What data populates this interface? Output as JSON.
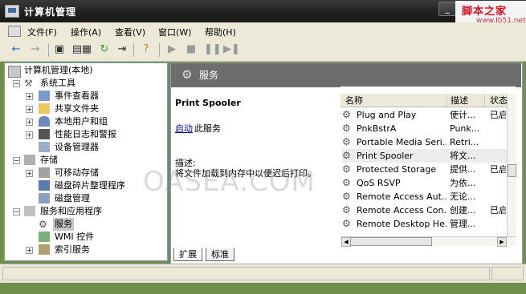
{
  "window": {
    "title": "计算机管理",
    "watermark_site": "脚本之家",
    "watermark_url": "www.Jb51.net",
    "center_watermark": "OASEA.COM"
  },
  "menubar": {
    "items": [
      "文件(F)",
      "操作(A)",
      "查看(V)",
      "窗口(W)",
      "帮助(H)"
    ]
  },
  "toolbar": {
    "icons": [
      "back-arrow-icon",
      "forward-arrow-icon",
      "up-folder-icon",
      "show-tree-icon",
      "properties-icon",
      "refresh-icon",
      "export-icon",
      "help-icon",
      "play-icon",
      "stop-icon",
      "pause-icon",
      "restart-icon"
    ]
  },
  "tree": {
    "root": "计算机管理(本地)",
    "system_tools": "系统工具",
    "event_viewer": "事件查看器",
    "shared_folders": "共享文件夹",
    "local_users": "本地用户和组",
    "perf_logs": "性能日志和警报",
    "device_manager": "设备管理器",
    "storage": "存储",
    "removable_storage": "可移动存储",
    "defrag": "磁盘碎片整理程序",
    "disk_management": "磁盘管理",
    "services_apps": "服务和应用程序",
    "services": "服务",
    "wmi": "WMI 控件",
    "indexing": "索引服务"
  },
  "right": {
    "header_title": "服务",
    "selected_service": "Print Spooler",
    "start_link": "启动",
    "start_suffix": "此服务",
    "desc_label": "描述:",
    "desc_text": "将文件加载到内存中以便迟后打印。"
  },
  "list": {
    "columns": [
      "名称",
      "描述",
      "状态"
    ],
    "rows": [
      {
        "name": "Plug and Play",
        "desc": "使计...",
        "status": "已启"
      },
      {
        "name": "PnkBstrA",
        "desc": "Punk...",
        "status": ""
      },
      {
        "name": "Portable Media Seri...",
        "desc": "Retri...",
        "status": ""
      },
      {
        "name": "Print Spooler",
        "desc": "将文...",
        "status": ""
      },
      {
        "name": "Protected Storage",
        "desc": "提供...",
        "status": "已启"
      },
      {
        "name": "QoS RSVP",
        "desc": "为依...",
        "status": ""
      },
      {
        "name": "Remote Access Aut...",
        "desc": "无论...",
        "status": ""
      },
      {
        "name": "Remote Access Con...",
        "desc": "创建...",
        "status": "已启"
      },
      {
        "name": "Remote Desktop He...",
        "desc": "管理...",
        "status": ""
      }
    ]
  },
  "tabs": [
    "扩展",
    "标准"
  ]
}
